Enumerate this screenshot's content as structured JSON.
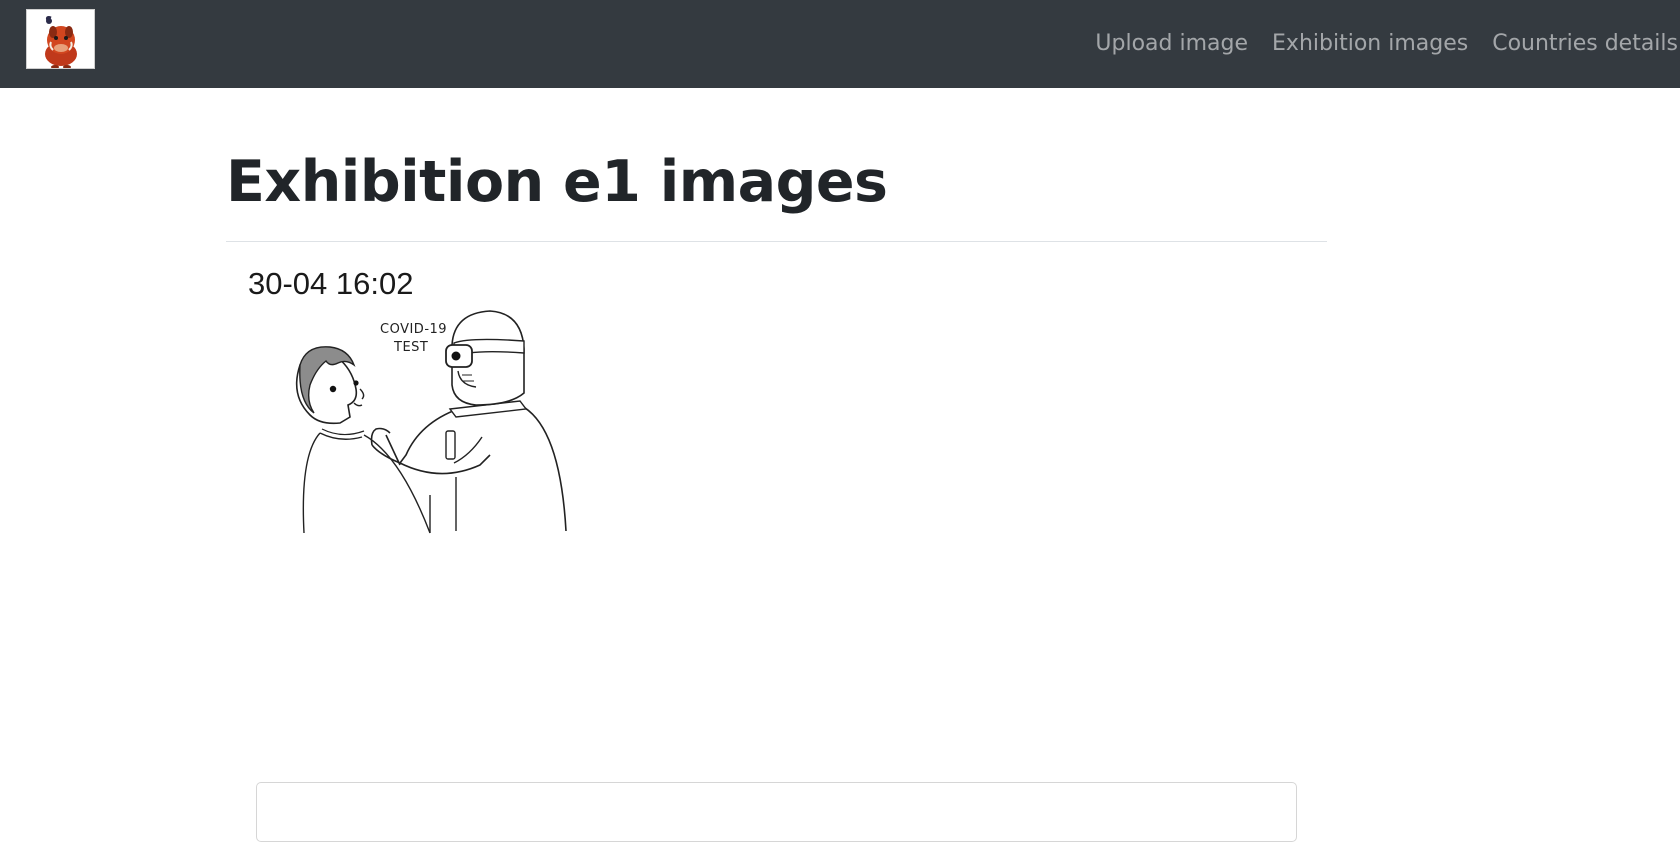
{
  "navbar": {
    "logo_icon": "warthog-mascot-icon",
    "links": [
      {
        "label": "Upload image"
      },
      {
        "label": "Exhibition images"
      },
      {
        "label": "Countries details"
      }
    ]
  },
  "main": {
    "title": "Exhibition e1 images",
    "image": {
      "timestamp": "30-04 16:02",
      "illustration_text_line1": "COVID-19",
      "illustration_text_line2": "TEST"
    }
  },
  "colors": {
    "navbar_bg": "#343a40",
    "nav_link": "#a0a3a6",
    "title": "#212529"
  }
}
